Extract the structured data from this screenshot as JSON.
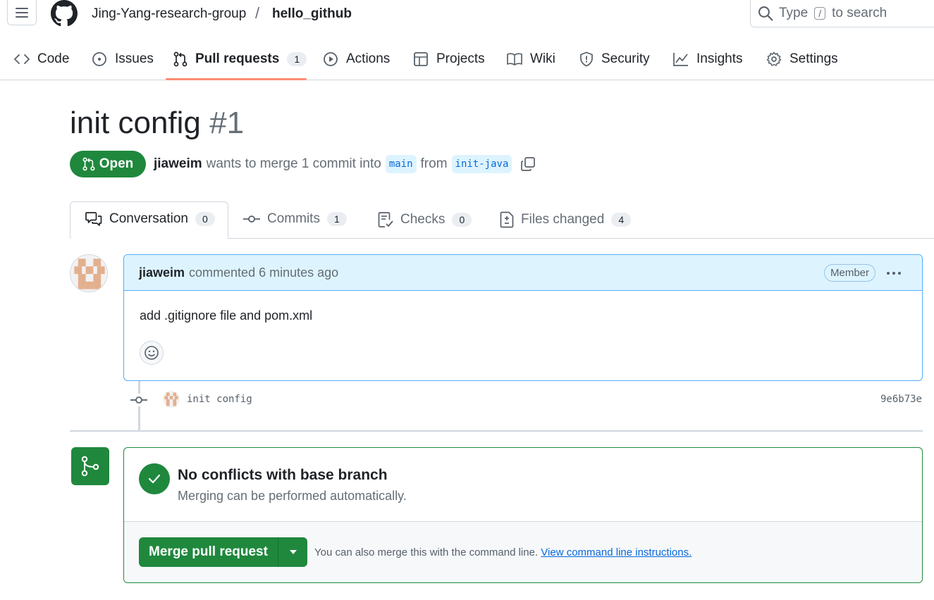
{
  "header": {
    "owner": "Jing-Yang-research-group",
    "separator": "/",
    "repo": "hello_github",
    "search": {
      "prefix": "Type",
      "key": "/",
      "suffix": "to search"
    }
  },
  "repo_nav": {
    "items": [
      {
        "label": "Code",
        "icon": "code-icon"
      },
      {
        "label": "Issues",
        "icon": "issue-icon"
      },
      {
        "label": "Pull requests",
        "icon": "pull-request-icon",
        "count": "1",
        "active": true
      },
      {
        "label": "Actions",
        "icon": "play-icon"
      },
      {
        "label": "Projects",
        "icon": "table-icon"
      },
      {
        "label": "Wiki",
        "icon": "book-icon"
      },
      {
        "label": "Security",
        "icon": "shield-icon"
      },
      {
        "label": "Insights",
        "icon": "graph-icon"
      },
      {
        "label": "Settings",
        "icon": "gear-icon"
      }
    ]
  },
  "pr": {
    "title": "init config",
    "number": "#1",
    "state": "Open",
    "author": "jiaweim",
    "summary": "wants to merge 1 commit into",
    "base_branch": "main",
    "from_word": "from",
    "head_branch": "init-java"
  },
  "tabs": [
    {
      "label": "Conversation",
      "count": "0",
      "icon": "comment-discussion-icon"
    },
    {
      "label": "Commits",
      "count": "1",
      "icon": "commit-icon"
    },
    {
      "label": "Checks",
      "count": "0",
      "icon": "checklist-icon"
    },
    {
      "label": "Files changed",
      "count": "4",
      "icon": "file-diff-icon"
    }
  ],
  "comment": {
    "author": "jiaweim",
    "action": "commented 6 minutes ago",
    "role": "Member",
    "body": "add .gitignore file and pom.xml"
  },
  "commit": {
    "message": "init config",
    "sha": "9e6b73e"
  },
  "merge": {
    "title": "No conflicts with base branch",
    "subtitle": "Merging can be performed automatically.",
    "button": "Merge pull request",
    "hint": "You can also merge this with the command line.",
    "link": "View command line instructions."
  },
  "colors": {
    "accent_green": "#1f883d",
    "link_blue": "#0969da",
    "tab_underline": "#fd8c73",
    "comment_header_bg": "#ddf4ff"
  }
}
